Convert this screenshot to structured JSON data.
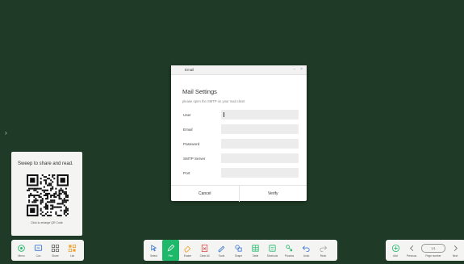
{
  "qr_panel": {
    "title": "Sweep to share and read.",
    "hint": "Click to enlarge QR Code"
  },
  "dialog": {
    "window_title": "Email",
    "heading": "Mail Settings",
    "subtitle": "please open the SMTP on your mail client",
    "fields": [
      {
        "label": "User",
        "value": ""
      },
      {
        "label": "Email",
        "value": ""
      },
      {
        "label": "Password",
        "value": ""
      },
      {
        "label": "SMTP Server",
        "value": ""
      },
      {
        "label": "Port",
        "value": ""
      }
    ],
    "cancel_label": "Cancel",
    "verify_label": "Verify"
  },
  "toolbar_left": [
    {
      "label": "Menu",
      "icon": "settings-icon"
    },
    {
      "label": "Con",
      "icon": "connect-icon"
    },
    {
      "label": "Share",
      "icon": "share-grid-icon"
    },
    {
      "label": "List",
      "icon": "list-grid-icon"
    }
  ],
  "toolbar_center": [
    {
      "label": "Select",
      "icon": "select-icon"
    },
    {
      "label": "Pen",
      "icon": "pen-icon",
      "active": true
    },
    {
      "label": "Eraser",
      "icon": "eraser-icon"
    },
    {
      "label": "Clear All",
      "icon": "clear-all-icon"
    },
    {
      "label": "Tools",
      "icon": "tools-icon"
    },
    {
      "label": "Shape",
      "icon": "shape-icon"
    },
    {
      "label": "Table",
      "icon": "table-icon"
    },
    {
      "label": "Shortcuts",
      "icon": "shortcuts-icon"
    },
    {
      "label": "Process",
      "icon": "process-icon"
    },
    {
      "label": "Undo",
      "icon": "undo-icon"
    },
    {
      "label": "Redo",
      "icon": "redo-icon"
    }
  ],
  "toolbar_right": {
    "add_label": "Add",
    "prev_label": "Previous",
    "page_indicator": "1/1",
    "page_caption": "Page number",
    "next_label": "Next"
  },
  "colors": {
    "background": "#1f3a26",
    "accent": "#1db86a"
  }
}
